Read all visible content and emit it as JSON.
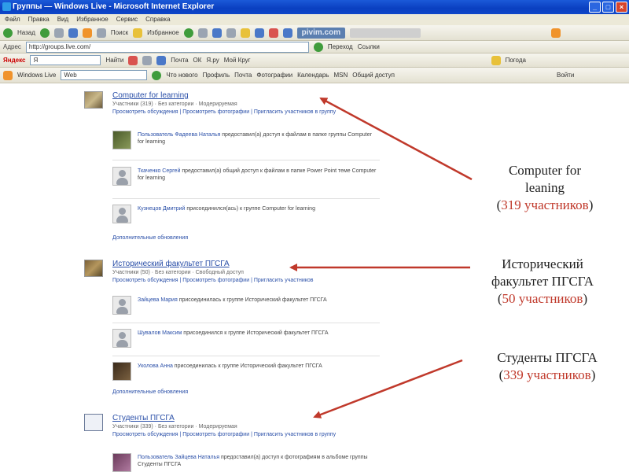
{
  "window": {
    "title": "Группы — Windows Live - Microsoft Internet Explorer",
    "menu": [
      "Файл",
      "Правка",
      "Вид",
      "Избранное",
      "Сервис",
      "Справка"
    ]
  },
  "toolbar": {
    "back_label": "Назад",
    "search_label": "Поиск",
    "favorites_label": "Избранное",
    "address_label": "Адрес",
    "address_value": "http://groups.live.com/",
    "go_label": "Переход",
    "links_label": "Ссылки",
    "pivim": "pivim.com"
  },
  "yandex_bar": {
    "brand": "Яндекс",
    "search_value": "Я",
    "find_label": "Найти",
    "items": [
      "Почта",
      "ОК",
      "Я.ру",
      "Мой Круг"
    ],
    "weather_label": "Погода"
  },
  "live_bar": {
    "brand": "Windows Live",
    "search_value": "Web",
    "items": [
      "Что нового",
      "Профиль",
      "Почта",
      "Фотографии",
      "Календарь",
      "MSN",
      "Общий доступ"
    ],
    "signin_label": "Войти"
  },
  "groups": [
    {
      "title": "Computer for learning",
      "meta": "Участники (319) · Без категории · Модерируемая",
      "links": "Просмотреть обсуждения  |  Просмотреть фотографии  |  Пригласить участников в группу",
      "posts": [
        {
          "author": "Пользователь Фадеева Наталья",
          "text": "предоставил(а) доступ к файлам в папке группы Computer for learning"
        },
        {
          "author": "Ткаченко Сергей",
          "text": "предоставил(а) общий доступ к файлам в папке Power Point теме Computer for learning"
        },
        {
          "author": "Кузнецов Дмитрий",
          "text": "присоединился(ась) к группе Computer for learning"
        }
      ],
      "more": "Дополнительные обновления"
    },
    {
      "title": "Исторический факультет ПГСГА",
      "meta": "Участники (50) · Без категории · Свободный доступ",
      "links": "Просмотреть обсуждения  |  Просмотреть фотографии  |  Пригласить участников",
      "posts": [
        {
          "author": "Зайцева Мария",
          "text": "присоединилась к группе Исторический факультет ПГСГА"
        },
        {
          "author": "Шувалов Максим",
          "text": "присоединился к группе Исторический факультет ПГСГА"
        },
        {
          "author": "Уколова Анна",
          "text": "присоединилась к группе Исторический факультет ПГСГА"
        }
      ],
      "more": "Дополнительные обновления"
    },
    {
      "title": "Студенты ПГСГА",
      "meta": "Участники (339) · Без категории · Модерируемая",
      "links": "Просмотреть обсуждения  |  Просмотреть фотографии  |  Пригласить участников в группу",
      "posts": [
        {
          "author": "Пользователь Зайцева Наталья",
          "text": "предоставил(а) доступ к фотографиям в альбоме группы Студенты ПГСГА"
        }
      ]
    }
  ],
  "annotations": [
    {
      "line1": "Computer for",
      "line2": "leaning",
      "count_open": "(",
      "count": "319 участников",
      "count_close": ")"
    },
    {
      "line1": "Исторический",
      "line2": "факультет ПГСГА",
      "count_open": "(",
      "count": "50 участников",
      "count_close": ")"
    },
    {
      "line1": "Студенты  ПГСГА",
      "line2": "",
      "count_open": "(",
      "count": "339  участников",
      "count_close": ")"
    }
  ],
  "colors": {
    "arrow": "#c0392b",
    "link": "#2a4fa8",
    "titlebar": "#0a3fc0"
  }
}
